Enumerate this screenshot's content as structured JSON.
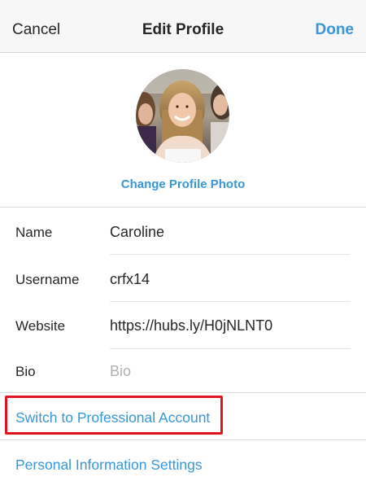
{
  "header": {
    "cancel_label": "Cancel",
    "title": "Edit Profile",
    "done_label": "Done"
  },
  "profile_photo": {
    "change_label": "Change Profile Photo"
  },
  "fields": {
    "name": {
      "label": "Name",
      "value": "Caroline"
    },
    "username": {
      "label": "Username",
      "value": "crfx14"
    },
    "website": {
      "label": "Website",
      "value": "https://hubs.ly/H0jNLNT0"
    },
    "bio": {
      "label": "Bio",
      "value": "",
      "placeholder": "Bio"
    }
  },
  "links": {
    "switch_professional": "Switch to Professional Account",
    "personal_info": "Personal Information Settings"
  },
  "colors": {
    "accent": "#3897d8",
    "highlight": "#e0141e",
    "text": "#262626",
    "placeholder": "#b2b2b2"
  }
}
